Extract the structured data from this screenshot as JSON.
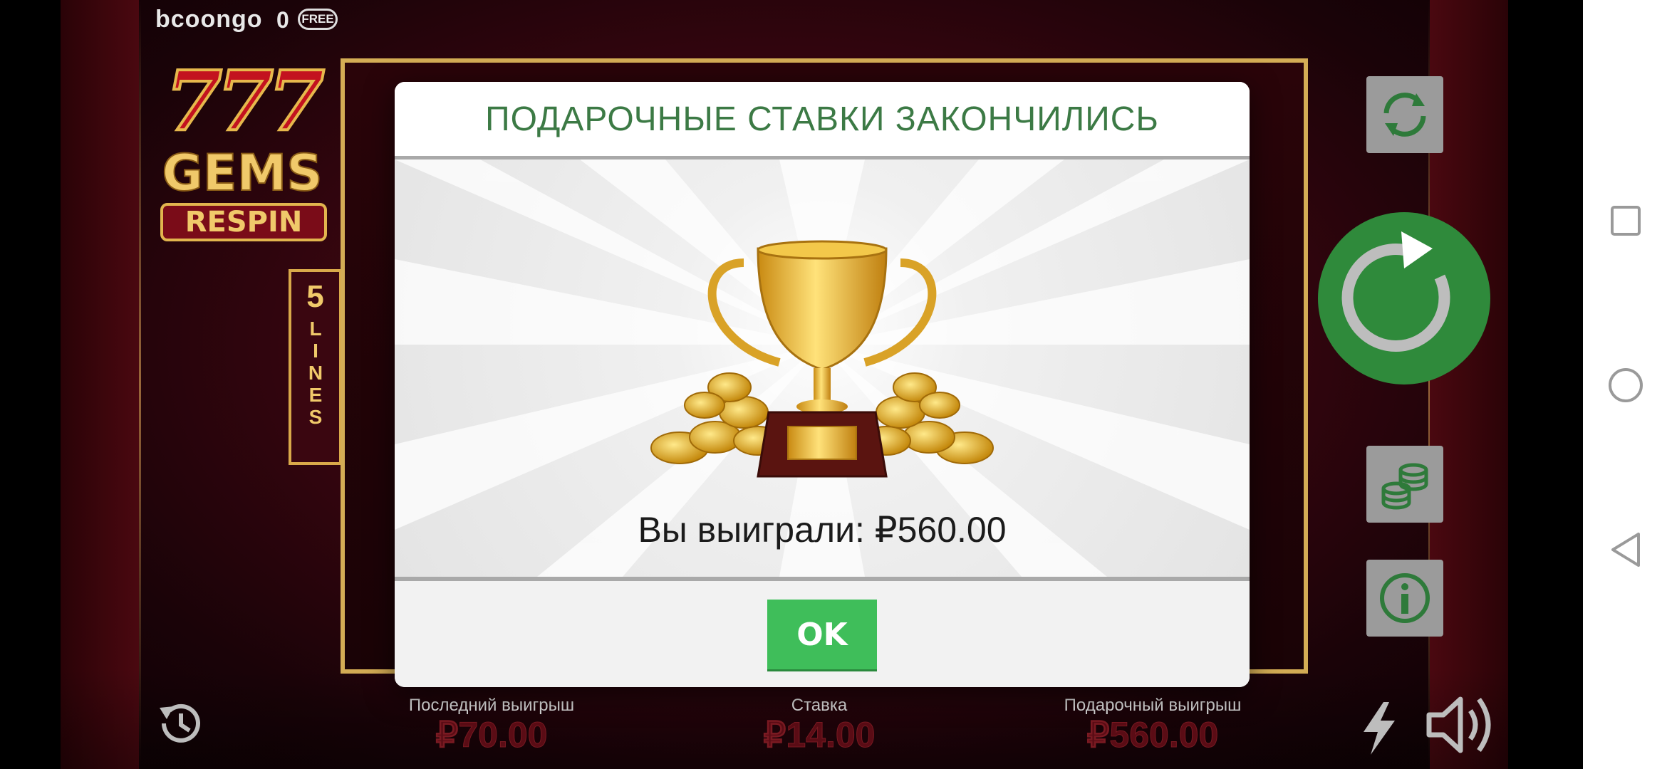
{
  "header": {
    "brand": "bcoongo",
    "free_count": "0",
    "free_badge": "FREE"
  },
  "logo": {
    "sevens": "777",
    "gems": "GEMS",
    "respin": "RESPIN"
  },
  "lines": {
    "number": "5",
    "word": "LINES"
  },
  "modal": {
    "title": "ПОДАРОЧНЫЕ СТАВКИ ЗАКОНЧИЛИСЬ",
    "win_text": "Вы выиграли: ₽560.00",
    "ok_label": "OK"
  },
  "bottom": {
    "last_win_label": "Последний выигрыш",
    "last_win_value": "₽70.00",
    "bet_label": "Ставка",
    "bet_value": "₽14.00",
    "gift_win_label": "Подарочный выигрыш",
    "gift_win_value": "₽560.00"
  },
  "icons": {
    "autoplay": "autoplay-icon",
    "spin": "spin-icon",
    "coins": "coins-icon",
    "info": "info-icon",
    "history": "history-icon",
    "turbo": "lightning-icon",
    "sound": "speaker-icon"
  },
  "colors": {
    "accent_green": "#3fbe5a",
    "spin_green": "#2f8a3b",
    "title_green": "#3c7a45",
    "frame_gold": "#d4ad55"
  }
}
